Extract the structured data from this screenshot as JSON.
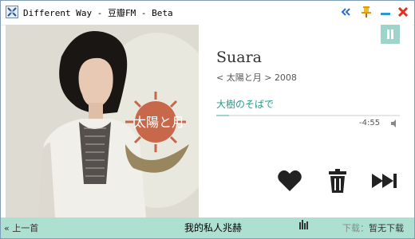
{
  "window": {
    "title": "Different Way - 豆瓣FM - Beta"
  },
  "player": {
    "artist": "Suara",
    "album_prefix": "< ",
    "album": "太陽と月",
    "album_suffix": " >",
    "year": "2008",
    "song": "大樹のそばで",
    "time_remaining": "-4:55",
    "progress": 0.07,
    "accent_color": "#9fd4cc",
    "song_color": "#2a9a86",
    "cover_text": "太陽と月"
  },
  "bottom": {
    "prev_label": "« 上一首",
    "station": "我的私人兆赫",
    "download_label": "下载：",
    "download_value": "暂无下载",
    "bar_color": "#aee0d2"
  },
  "icons": {
    "app": "app-icon",
    "collapse": "double-chevron-left-icon",
    "pin": "pin-icon",
    "minimize": "minimize-icon",
    "close": "close-icon",
    "pause": "pause-icon",
    "volume": "volume-icon",
    "heart": "heart-icon",
    "trash": "trash-icon",
    "skip": "skip-forward-icon",
    "bars": "equalizer-bars-icon"
  }
}
